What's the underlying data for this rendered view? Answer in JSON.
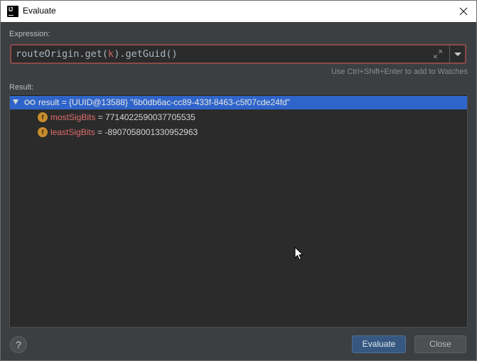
{
  "window": {
    "title": "Evaluate",
    "app_icon": "intellij-icon",
    "close_icon": "close-icon"
  },
  "expression": {
    "label": "Expression:",
    "value_prefix": "routeOrigin.get(",
    "value_arg": "k",
    "value_suffix": ").getGuid()",
    "hint": "Use Ctrl+Shift+Enter to add to Watches"
  },
  "result": {
    "label": "Result:",
    "root": {
      "text": "result = {UUID@13588} \"6b0db6ac-cc89-433f-8463-c5f07cde24fd\"",
      "icon": "watch-glasses-icon"
    },
    "children": [
      {
        "name": "mostSigBits",
        "eq": " = ",
        "value": "7714022590037705535",
        "icon_letter": "f"
      },
      {
        "name": "leastSigBits",
        "eq": " = ",
        "value": "-8907058001330952963",
        "icon_letter": "f"
      }
    ]
  },
  "buttons": {
    "help": "?",
    "evaluate": "Evaluate",
    "close": "Close"
  },
  "colors": {
    "background": "#3c3f41",
    "panel": "#2b2b2b",
    "selection": "#2f65ca",
    "error_border": "#8a4a4a",
    "field_name": "#e06c6c",
    "primary_button": "#365880"
  }
}
